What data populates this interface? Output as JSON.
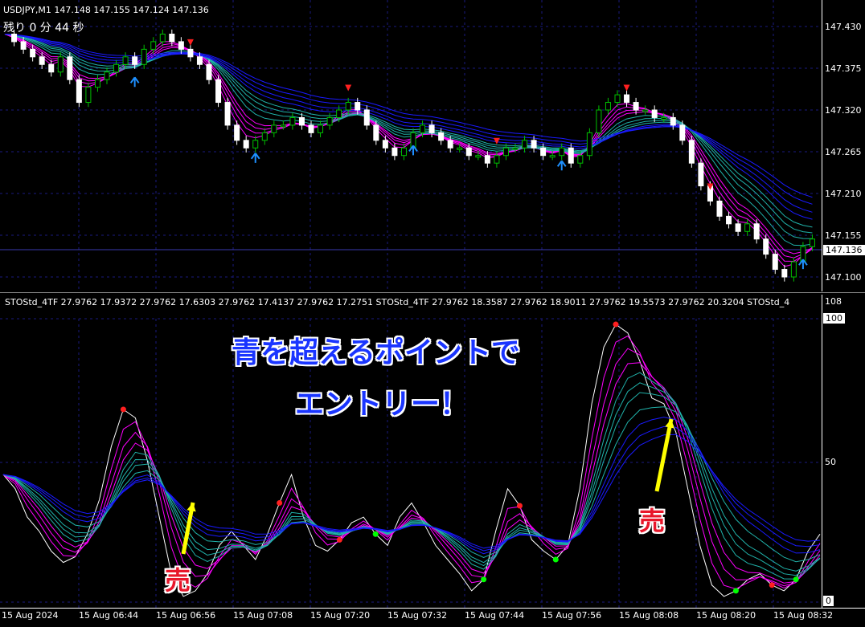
{
  "main_chart": {
    "symbol_header": "USDJPY,M1  147.148 147.155 147.124 147.136",
    "timer_text": "残り 0 分 44 秒",
    "price_labels": [
      "147.430",
      "147.375",
      "147.320",
      "147.265",
      "147.210",
      "147.155",
      "147.100"
    ],
    "current_price": "147.136"
  },
  "indicator": {
    "header": "STOStd_4TF 27.9762 17.9372 27.9762 17.6303 27.9762 17.4137 27.9762 17.2751  STOStd_4TF 27.9762 18.3587 27.9762 18.9011 27.9762 19.5573 27.9762 20.3204  STOStd_4",
    "max_label": "108",
    "level_100": "100",
    "level_50": "50",
    "level_0": "0"
  },
  "time_labels": [
    "15 Aug 2024",
    "15 Aug 06:44",
    "15 Aug 06:56",
    "15 Aug 07:08",
    "15 Aug 07:20",
    "15 Aug 07:32",
    "15 Aug 07:44",
    "15 Aug 07:56",
    "15 Aug 08:08",
    "15 Aug 08:20",
    "15 Aug 08:32"
  ],
  "annotations": {
    "headline_line1": "青を超えるポイントで",
    "headline_line2": "エントリー！",
    "sell_label_1": "売",
    "sell_label_2": "売"
  },
  "colors": {
    "background": "#000000",
    "bull_candle": "#00c000",
    "bear_candle": "#ffffff",
    "ribbon_fast": "#ff00ff",
    "ribbon_mid": "#20b2aa",
    "ribbon_slow": "#1a1aff",
    "sell_arrow": "#ff2020",
    "buy_arrow": "#1e90ff",
    "headline": "#1a35ff",
    "callout_arrow": "#ffff00"
  },
  "price_series": [
    147.42,
    147.41,
    147.4,
    147.39,
    147.38,
    147.37,
    147.39,
    147.36,
    147.33,
    147.35,
    147.36,
    147.37,
    147.38,
    147.39,
    147.38,
    147.4,
    147.41,
    147.42,
    147.41,
    147.4,
    147.39,
    147.38,
    147.36,
    147.33,
    147.3,
    147.28,
    147.27,
    147.28,
    147.29,
    147.3,
    147.3,
    147.31,
    147.3,
    147.29,
    147.3,
    147.31,
    147.32,
    147.33,
    147.32,
    147.3,
    147.28,
    147.27,
    147.26,
    147.27,
    147.29,
    147.3,
    147.29,
    147.28,
    147.27,
    147.27,
    147.26,
    147.26,
    147.25,
    147.26,
    147.27,
    147.27,
    147.28,
    147.27,
    147.26,
    147.26,
    147.27,
    147.25,
    147.26,
    147.29,
    147.32,
    147.33,
    147.34,
    147.33,
    147.32,
    147.32,
    147.31,
    147.31,
    147.3,
    147.28,
    147.25,
    147.22,
    147.2,
    147.18,
    147.17,
    147.16,
    147.17,
    147.15,
    147.13,
    147.11,
    147.1,
    147.12,
    147.14,
    147.15
  ],
  "stoch_series": [
    45,
    40,
    30,
    25,
    18,
    14,
    16,
    24,
    36,
    55,
    68,
    65,
    50,
    30,
    10,
    2,
    4,
    10,
    20,
    25,
    20,
    15,
    24,
    35,
    45,
    30,
    20,
    18,
    22,
    28,
    30,
    24,
    20,
    30,
    35,
    28,
    20,
    15,
    10,
    4,
    8,
    25,
    40,
    34,
    22,
    18,
    15,
    20,
    40,
    70,
    90,
    98,
    95,
    85,
    72,
    70,
    60,
    40,
    20,
    6,
    2,
    4,
    8,
    10,
    6,
    4,
    8,
    18,
    24
  ]
}
